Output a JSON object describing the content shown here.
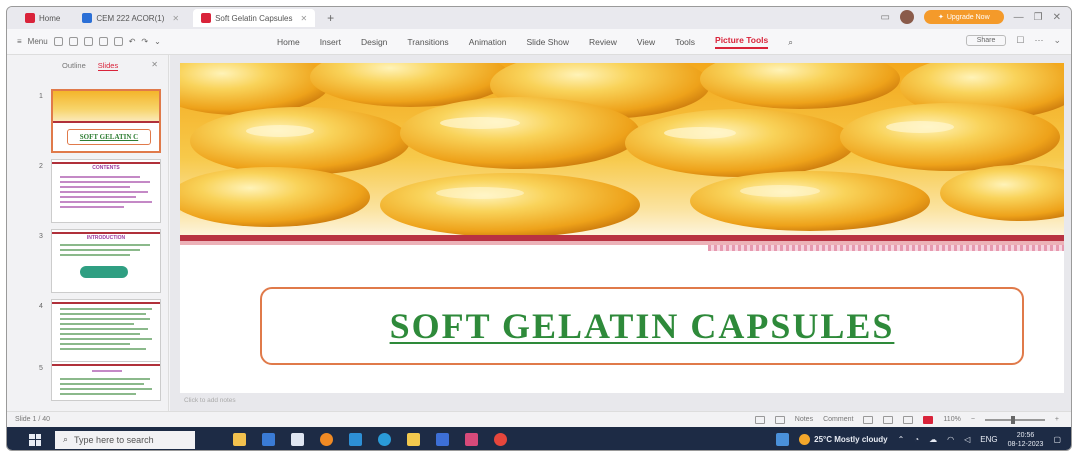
{
  "tabs": [
    {
      "label": "Home",
      "color": "#d9233a"
    },
    {
      "label": "CEM 222 ACOR(1)",
      "color": "#2b6fd6"
    },
    {
      "label": "Soft Gelatin Capsules",
      "color": "#d9233a"
    }
  ],
  "upgrade_label": "Upgrade Now",
  "menu_label": "Menu",
  "ribbon_tabs": [
    "Home",
    "Insert",
    "Design",
    "Transitions",
    "Animation",
    "Slide Show",
    "Review",
    "View",
    "Tools",
    "Picture Tools"
  ],
  "active_ribbon_tab": "Picture Tools",
  "share_label": "Share",
  "panel_tabs": {
    "outline": "Outline",
    "slides": "Slides"
  },
  "thumbnails": [
    {
      "num": "1",
      "title": "SOFT GELATIN C"
    },
    {
      "num": "2",
      "title": "CONTENTS"
    },
    {
      "num": "3",
      "title": "INTRODUCTION"
    },
    {
      "num": "4",
      "title": ""
    },
    {
      "num": "5",
      "title": ""
    }
  ],
  "slide": {
    "title": "SOFT GELATIN CAPSULES"
  },
  "notes_placeholder": "Click to add notes",
  "status": {
    "slide_counter": "Slide 1 / 40",
    "notes": "Notes",
    "comment": "Comment",
    "zoom": "110%"
  },
  "taskbar": {
    "search_placeholder": "Type here to search",
    "weather": "25°C  Mostly cloudy",
    "lang": "ENG",
    "time": "20:56",
    "date": "08-12-2023"
  },
  "colors": {
    "accent": "#d9233a",
    "title_green": "#2e8a3a",
    "title_border": "#e07a4a",
    "divider": "#b83242",
    "taskbar": "#1d2b45"
  }
}
